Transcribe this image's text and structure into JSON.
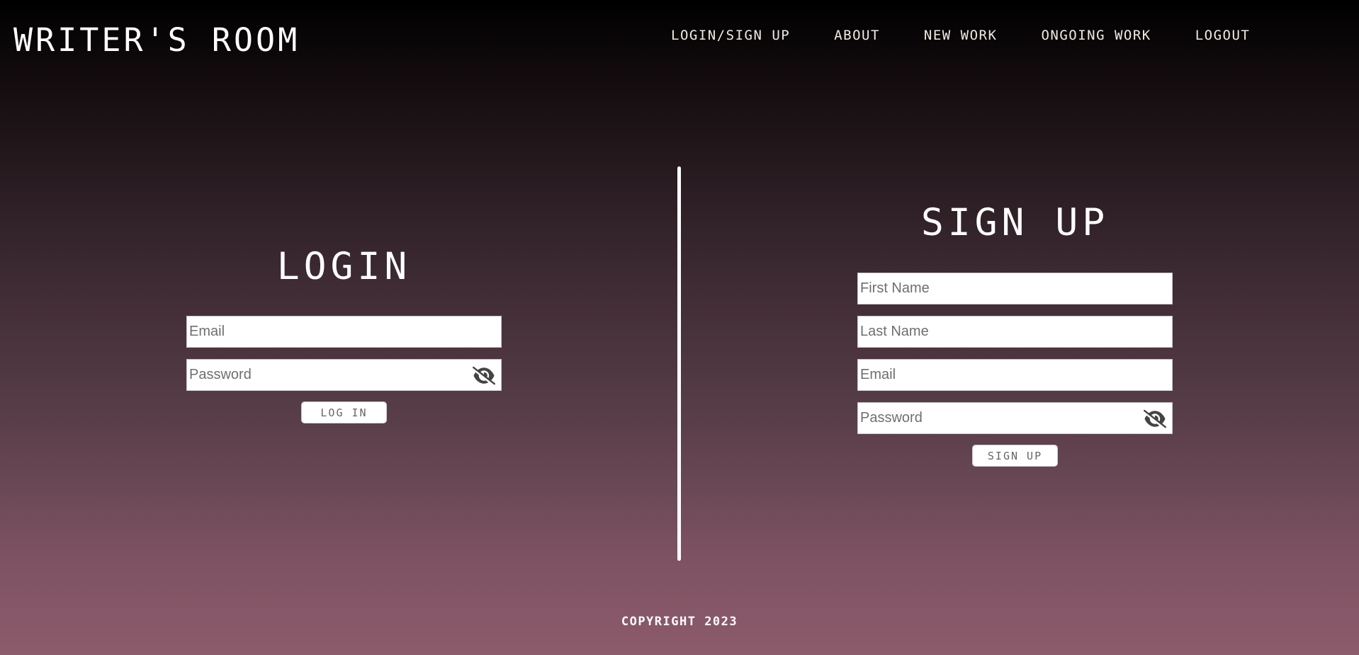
{
  "header": {
    "logo": "WRITER'S ROOM",
    "nav": [
      {
        "label": "LOGIN/SIGN UP"
      },
      {
        "label": "ABOUT"
      },
      {
        "label": "NEW WORK"
      },
      {
        "label": "ONGOING WORK"
      },
      {
        "label": "LOGOUT"
      }
    ]
  },
  "login": {
    "title": "LOGIN",
    "email_placeholder": "Email",
    "password_placeholder": "Password",
    "button_label": "LOG IN",
    "password_toggle_icon": "eye-slash-icon"
  },
  "signup": {
    "title": "SIGN UP",
    "first_name_placeholder": "First Name",
    "last_name_placeholder": "Last Name",
    "email_placeholder": "Email",
    "password_placeholder": "Password",
    "button_label": "SIGN UP",
    "password_toggle_icon": "eye-slash-icon"
  },
  "footer": {
    "copyright": "COPYRIGHT 2023"
  },
  "colors": {
    "gradient_top": "#000000",
    "gradient_bottom": "#8c5b6c",
    "text": "#ffffff",
    "field_bg": "#ffffff"
  }
}
